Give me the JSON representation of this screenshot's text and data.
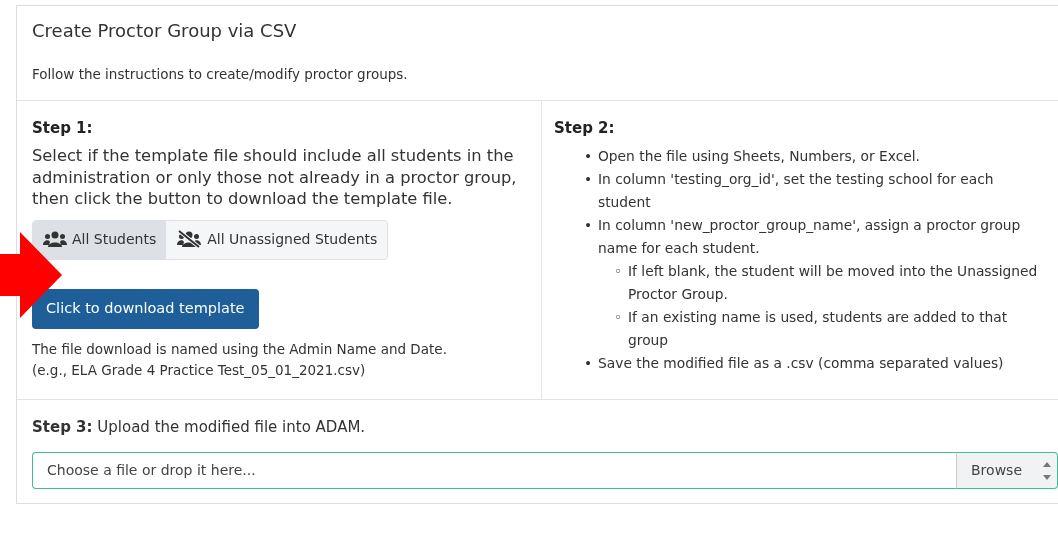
{
  "card": {
    "title": "Create Proctor Group via CSV",
    "subtitle": "Follow the instructions to create/modify proctor groups."
  },
  "step1": {
    "heading": "Step 1:",
    "text": "Select if the template file should include all students in the administration or only those not already in a proctor group, then click the button to download the template file.",
    "options": [
      {
        "label": "All Students",
        "kind": "all",
        "selected": true
      },
      {
        "label": "All Unassigned Students",
        "kind": "unassigned",
        "selected": false
      }
    ],
    "button": "Click to download template",
    "note": "The file download is named using the Admin Name and Date.\n(e.g., ELA Grade 4 Practice Test_05_01_2021.csv)"
  },
  "step2": {
    "heading": "Step 2:",
    "items": [
      {
        "marker": "•",
        "text": "Open the file using Sheets, Numbers, or Excel."
      },
      {
        "marker": "•",
        "text": "In column 'testing_org_id', set the testing school for each student"
      },
      {
        "marker": "•",
        "text": "In column 'new_proctor_group_name', assign a proctor group name for each student.",
        "children": [
          {
            "marker": "◦",
            "text": "If left blank, the student will be moved into the Unassigned Proctor Group."
          },
          {
            "marker": "◦",
            "text": "If an existing name is used, students are added to that group"
          }
        ]
      },
      {
        "marker": "•",
        "text": "Save the modified file as a .csv (comma separated values)"
      }
    ]
  },
  "step3": {
    "text": "**Step 3:** Upload the modified file into ADAM.",
    "placeholder": "Choose a file or drop it here...",
    "browse": "Browse"
  },
  "annotation": {
    "kind": "arrow"
  }
}
